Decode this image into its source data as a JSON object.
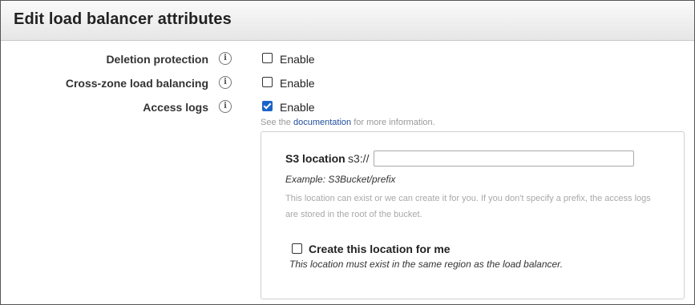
{
  "header": {
    "title": "Edit load balancer attributes"
  },
  "attributes": [
    {
      "label": "Deletion protection",
      "checkbox_label": "Enable",
      "checked": false
    },
    {
      "label": "Cross-zone load balancing",
      "checkbox_label": "Enable",
      "checked": false
    },
    {
      "label": "Access logs",
      "checkbox_label": "Enable",
      "checked": true
    }
  ],
  "info_icon": "info-icon",
  "hint": {
    "prefix": "See the",
    "link": "documentation",
    "suffix": "for more information."
  },
  "access_logs_panel": {
    "s3_label": "S3 location",
    "s3_prefix": "s3://",
    "s3_value": "",
    "example": "Example: S3Bucket/prefix",
    "note_line1": "This location can exist or we can create it for you. If you don't specify a prefix, the access logs",
    "note_line2": "are stored in the root of the bucket.",
    "create_label": "Create this location for me",
    "create_checked": false,
    "region_note": "This location must exist in the same region as the load balancer."
  },
  "colors": {
    "accent": "#1a64c8",
    "link": "#1f4e9c",
    "muted": "#a8a8a8"
  }
}
